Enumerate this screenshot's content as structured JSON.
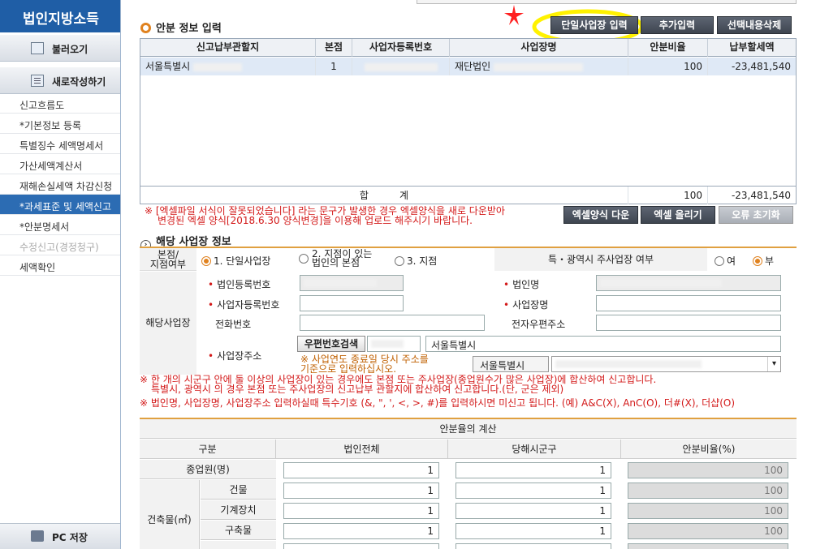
{
  "sidebar": {
    "title": "법인지방소득",
    "load_label": "불러오기",
    "new_label": "새로작성하기",
    "items": [
      {
        "label": "신고흐름도"
      },
      {
        "label": "*기본정보 등록"
      },
      {
        "label": "특별징수 세액명세서"
      },
      {
        "label": "가산세액계산서"
      },
      {
        "label": "재해손실세액 차감신청"
      },
      {
        "label": "*과세표준 및 세액신고"
      },
      {
        "label": "*안분명세서"
      },
      {
        "label": "수정신고(경정청구)"
      },
      {
        "label": "세액확인"
      }
    ],
    "pc_save_label": "PC 저장"
  },
  "apportion": {
    "title": "안분 정보 입력",
    "buttons": {
      "single": "단일사업장 입력",
      "add": "추가입력",
      "delete": "선택내용삭제"
    },
    "headers": [
      "신고납부관할지",
      "본점",
      "사업자등록번호",
      "사업장명",
      "안분비율",
      "납부할세액"
    ],
    "row": {
      "jurisdiction": "서울특별시",
      "head": "1",
      "brn": "",
      "name": "재단법인",
      "ratio": "100",
      "tax": "-23,481,540"
    },
    "total": {
      "label": "합          계",
      "ratio": "100",
      "tax": "-23,481,540"
    },
    "warning_line1": "※ [엑셀파일 서식이 잘못되었습니다] 라는 문구가 발생한 경우 엑셀양식을 새로 다운받아",
    "warning_line2": "변경된 엑셀 양식[2018.6.30 양식변경]을 이용해 업로드 해주시기 바랍니다.",
    "excel_buttons": {
      "download": "엑셀양식 다운",
      "upload": "엑셀 올리기",
      "reset": "오류 초기화"
    }
  },
  "site": {
    "title": "해당 사업장 정보",
    "type_label": "본점/\n지점여부",
    "type_options": [
      "1. 단일사업장",
      "2. 지점이 있는\n법인의 본점",
      "3. 지점"
    ],
    "metro_label": "특・광역시 주사업장 여부",
    "metro_yes": "여",
    "metro_no": "부",
    "group_label": "해당사업장",
    "corp_reg_no": "법인등록번호",
    "corp_name": "법인명",
    "biz_reg_no": "사업자등록번호",
    "biz_name": "사업장명",
    "phone": "전화번호",
    "email": "전자우편주소",
    "address": "사업장주소",
    "zip_search": "우편번호검색",
    "address_value": "서울특별시",
    "address_note": "※ 사업연도 종료일 당시 주소를\n기준으로 입력하십시오.",
    "city_select": "서울특별시",
    "note1": "※ 한 개의 시군구 안에 둘 이상의 사업장이 있는 경우에도 본점 또는 주사업장(종업원수가 많은 사업장)에 합산하여 신고합니다.",
    "note2": "특별시, 광역시 의 경우 본점 또는 주사업장의 신고납부 관할지에 합산하여 신고합니다.(단, 군은 제외)",
    "note3": "※ 법인명, 사업장명, 사업장주소 입력하실때 특수기호 (&, \", ', <, >, #)를 입력하시면 미신고 됩니다. (예) A&C(X), AnC(O), 더#(X), 더샵(O)"
  },
  "calc": {
    "title": "안분율의 계산",
    "headers": [
      "구분",
      "법인전체",
      "당해시군구",
      "안분비율(%)"
    ],
    "employees": {
      "label": "종업원(명)",
      "total": "1",
      "local": "1",
      "ratio": "100"
    },
    "building_group": "건축물(㎡)",
    "rows": [
      {
        "label": "건물",
        "total": "1",
        "local": "1",
        "ratio": "100"
      },
      {
        "label": "기계장치",
        "total": "1",
        "local": "1",
        "ratio": "100"
      },
      {
        "label": "구축물",
        "total": "1",
        "local": "1",
        "ratio": "100"
      }
    ]
  }
}
